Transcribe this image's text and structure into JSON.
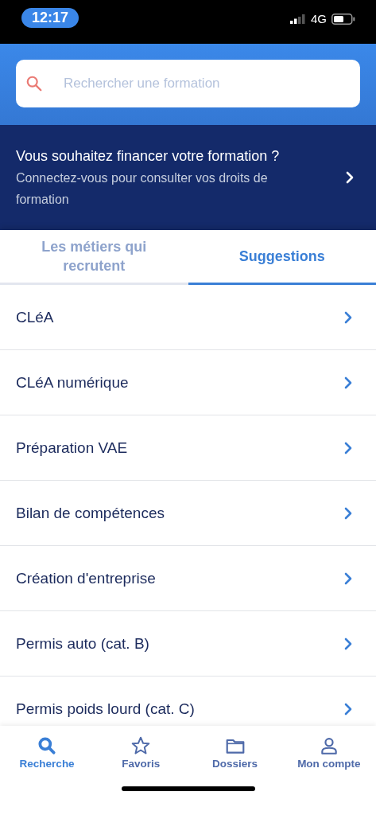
{
  "status_bar": {
    "time": "12:17",
    "network": "4G"
  },
  "search": {
    "placeholder": "Rechercher une formation"
  },
  "banner": {
    "title": "Vous souhaitez financer votre formation ?",
    "subtitle": "Connectez-vous pour consulter vos droits de formation"
  },
  "tabs": [
    {
      "label": "Les métiers qui recrutent",
      "selected": false
    },
    {
      "label": "Suggestions",
      "selected": true
    }
  ],
  "suggestions": [
    {
      "label": "CLéA"
    },
    {
      "label": "CLéA numérique"
    },
    {
      "label": "Préparation VAE"
    },
    {
      "label": "Bilan de compétences"
    },
    {
      "label": "Création d'entreprise"
    },
    {
      "label": "Permis auto (cat. B)"
    },
    {
      "label": "Permis poids lourd (cat. C)"
    }
  ],
  "bottom_nav": [
    {
      "label": "Recherche",
      "selected": true
    },
    {
      "label": "Favoris",
      "selected": false
    },
    {
      "label": "Dossiers",
      "selected": false
    },
    {
      "label": "Mon compte",
      "selected": false
    }
  ]
}
